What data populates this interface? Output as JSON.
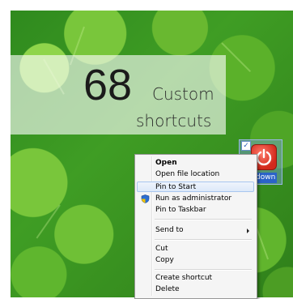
{
  "title": {
    "number": "68",
    "word1": "Custom",
    "word2": "shortcuts"
  },
  "shortcut": {
    "label": "down",
    "icon": "power-icon",
    "checked": true
  },
  "context_menu": {
    "items": [
      {
        "label": "Open",
        "bold": true
      },
      {
        "label": "Open file location"
      },
      {
        "label": "Pin to Start",
        "hover": true
      },
      {
        "label": "Run as administrator",
        "icon": "shield-icon"
      },
      {
        "label": "Pin to Taskbar"
      },
      {
        "label": "Send to",
        "submenu": true
      },
      {
        "label": "Cut"
      },
      {
        "label": "Copy"
      },
      {
        "label": "Create shortcut"
      },
      {
        "label": "Delete"
      }
    ]
  },
  "colors": {
    "menu_hover": "#dde9f9",
    "selection_blue": "#2b63c8",
    "power_red": "#d22a1c"
  }
}
